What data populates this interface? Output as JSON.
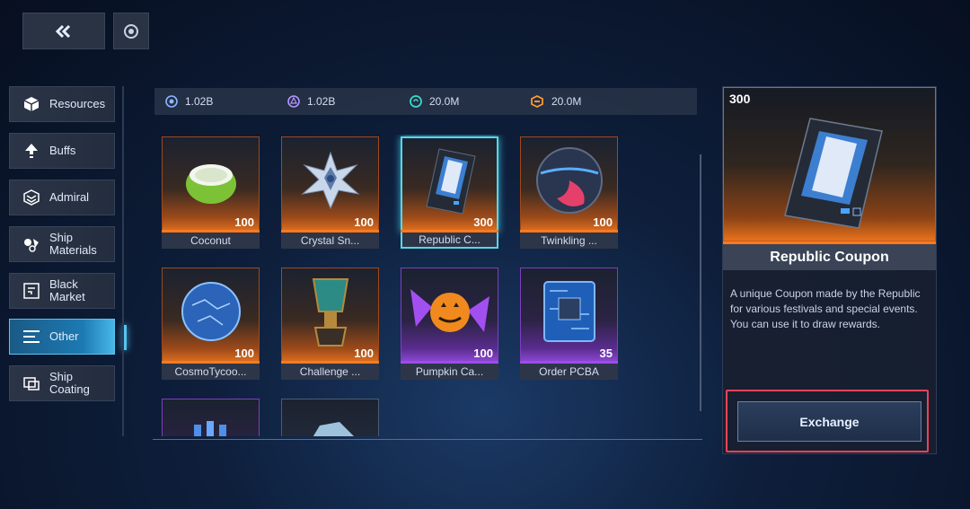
{
  "sidebar": {
    "items": [
      {
        "label": "Resources",
        "icon": "cube-icon"
      },
      {
        "label": "Buffs",
        "icon": "arrow-up-icon"
      },
      {
        "label": "Admiral",
        "icon": "chevron-badge-icon"
      },
      {
        "label": "Ship\nMaterials",
        "icon": "materials-icon"
      },
      {
        "label": "Black\nMarket",
        "icon": "market-icon"
      },
      {
        "label": "Other",
        "icon": "menu-lines-icon",
        "active": true
      },
      {
        "label": "Ship\nCoating",
        "icon": "coating-icon"
      }
    ]
  },
  "currencies": [
    {
      "value": "1.02B",
      "icon": "gear-coin-icon"
    },
    {
      "value": "1.02B",
      "icon": "atom-coin-icon"
    },
    {
      "value": "20.0M",
      "icon": "swirl-coin-icon"
    },
    {
      "value": "20.0M",
      "icon": "orange-coin-icon"
    }
  ],
  "items": [
    {
      "name": "Coconut",
      "qty": "100",
      "rarity": "orange",
      "art": "coconut"
    },
    {
      "name": "Crystal Sn...",
      "qty": "100",
      "rarity": "orange",
      "art": "crystal"
    },
    {
      "name": "Republic C...",
      "qty": "300",
      "rarity": "orange",
      "art": "coupon",
      "selected": true
    },
    {
      "name": "Twinkling ...",
      "qty": "100",
      "rarity": "orange",
      "art": "orb"
    },
    {
      "name": "CosmoTycoo...",
      "qty": "100",
      "rarity": "orange",
      "art": "glassball"
    },
    {
      "name": "Challenge ...",
      "qty": "100",
      "rarity": "orange",
      "art": "trophy"
    },
    {
      "name": "Pumpkin Ca...",
      "qty": "100",
      "rarity": "purple",
      "art": "candy"
    },
    {
      "name": "Order PCBA",
      "qty": "35",
      "rarity": "purple",
      "art": "chip"
    },
    {
      "name": "",
      "qty": "",
      "rarity": "purple",
      "art": "vials"
    },
    {
      "name": "",
      "qty": "",
      "rarity": "plain",
      "art": "shard"
    }
  ],
  "detail": {
    "qty": "300",
    "title": "Republic Coupon",
    "description": "A unique Coupon made by the Republic for various festivals and special events. You can use it to draw rewards.",
    "exchange_label": "Exchange"
  },
  "colors": {
    "orange": "#ff7a1e",
    "purple": "#a14af0",
    "accent": "#53c6f0",
    "highlight": "#e8445a"
  }
}
